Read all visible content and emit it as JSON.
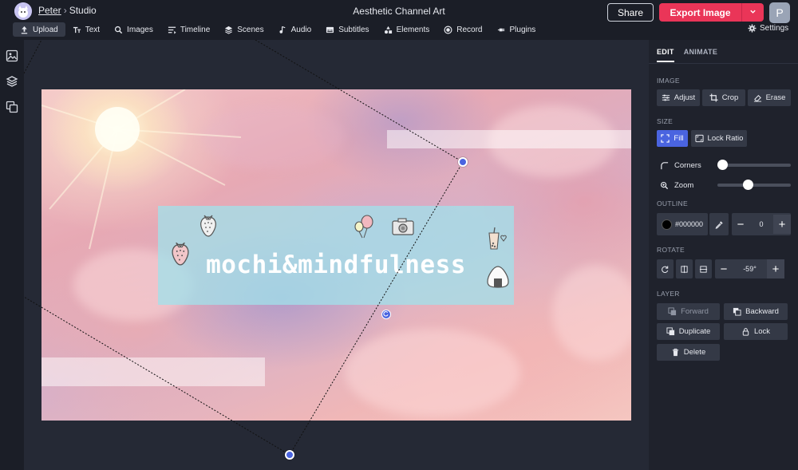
{
  "header": {
    "breadcrumb_user": "Peter",
    "breadcrumb_separator": "›",
    "breadcrumb_location": "Studio",
    "document_title": "Aesthetic Channel Art",
    "share_label": "Share",
    "export_label": "Export Image",
    "user_initial": "P"
  },
  "toolbar": {
    "items": [
      {
        "label": "Upload",
        "icon": "upload-icon",
        "active": true
      },
      {
        "label": "Text",
        "icon": "text-icon"
      },
      {
        "label": "Images",
        "icon": "search-icon"
      },
      {
        "label": "Timeline",
        "icon": "timeline-icon"
      },
      {
        "label": "Scenes",
        "icon": "layers-icon"
      },
      {
        "label": "Audio",
        "icon": "music-note-icon"
      },
      {
        "label": "Subtitles",
        "icon": "subtitles-icon"
      },
      {
        "label": "Elements",
        "icon": "shapes-icon"
      },
      {
        "label": "Record",
        "icon": "record-icon"
      },
      {
        "label": "Plugins",
        "icon": "plugin-icon"
      }
    ],
    "settings_label": "Settings"
  },
  "canvas": {
    "banner_text": "mochi&mindfulness"
  },
  "panel": {
    "tabs": [
      "EDIT",
      "ANIMATE"
    ],
    "image_section": "IMAGE",
    "adjust_label": "Adjust",
    "crop_label": "Crop",
    "erase_label": "Erase",
    "size_section": "SIZE",
    "fill_label": "Fill",
    "lock_ratio_label": "Lock Ratio",
    "corners_label": "Corners",
    "zoom_label": "Zoom",
    "corners_value": 0.0,
    "zoom_value": 0.4,
    "outline_section": "OUTLINE",
    "outline_color": "#000000",
    "outline_width": "0",
    "rotate_section": "ROTATE",
    "rotate_value": "-59°",
    "layer_section": "LAYER",
    "forward_label": "Forward",
    "backward_label": "Backward",
    "duplicate_label": "Duplicate",
    "lock_label": "Lock",
    "delete_label": "Delete"
  },
  "colors": {
    "accent": "#4a64e0",
    "export": "#ea3558",
    "banner": "#a0e1eb"
  }
}
